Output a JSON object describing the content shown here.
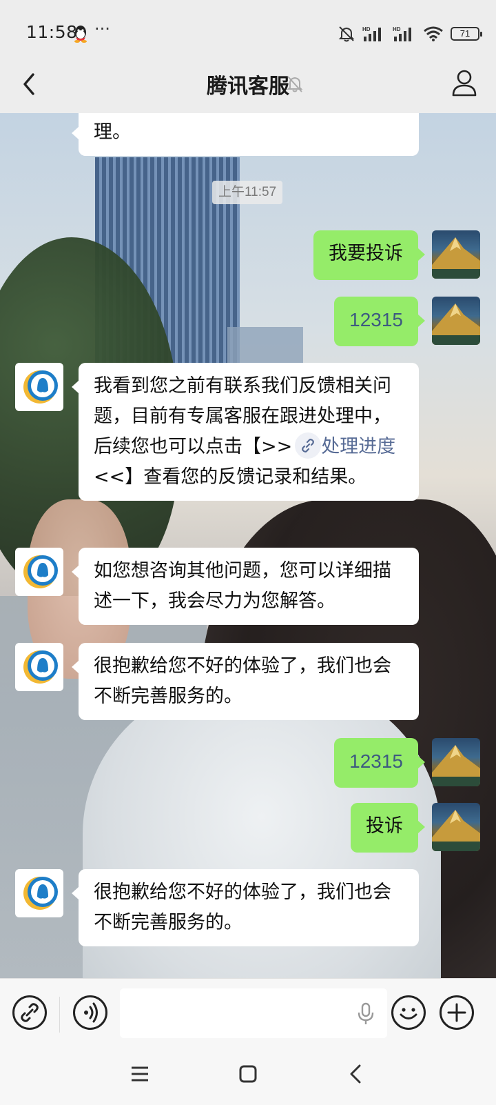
{
  "status_bar": {
    "time": "11:58",
    "more": "···",
    "battery": "71",
    "icons": [
      "qq-icon",
      "mute-icon",
      "hd-signal-icon",
      "hd-signal-icon",
      "wifi-icon",
      "battery-icon"
    ]
  },
  "header": {
    "title": "腾讯客服",
    "icons": [
      "back-icon",
      "mute-bell-icon",
      "profile-icon"
    ]
  },
  "chat": {
    "timestamp": "上午11:57",
    "messages": [
      {
        "side": "in",
        "text": "理。",
        "partial": true
      },
      {
        "side": "out",
        "text": "我要投诉"
      },
      {
        "side": "out",
        "text": "12315"
      },
      {
        "side": "in",
        "text_before": "我看到您之前有联系我们反馈相关问题，目前有专属客服在跟进处理中，后续您也可以点击【>>",
        "link": "处理进度",
        "text_after": "<<】查看您的反馈记录和结果。"
      },
      {
        "side": "in",
        "text": "如您想咨询其他问题，您可以详细描述一下，我会尽力为您解答。"
      },
      {
        "side": "in",
        "text": "很抱歉给您不好的体验了，我们也会不断完善服务的。"
      },
      {
        "side": "out",
        "text": "12315"
      },
      {
        "side": "out",
        "text": "投诉"
      },
      {
        "side": "in",
        "text": "很抱歉给您不好的体验了，我们也会不断完善服务的。"
      }
    ]
  },
  "input_bar": {
    "icons": [
      "link-icon",
      "voice-icon",
      "mic-icon",
      "emoji-icon",
      "plus-icon"
    ],
    "placeholder": ""
  },
  "system_nav": {
    "icons": [
      "menu-icon",
      "home-icon",
      "back-nav-icon"
    ]
  }
}
